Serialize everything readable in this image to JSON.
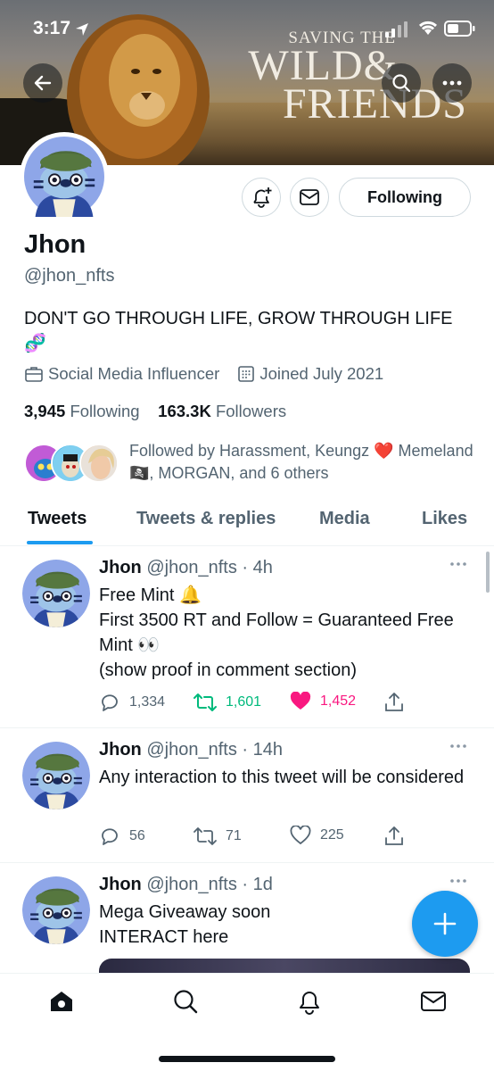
{
  "status_bar": {
    "time": "3:17"
  },
  "banner": {
    "line1": "SAVING THE",
    "line2": "WILD&",
    "line3": "FRIENDS"
  },
  "profile": {
    "name": "Jhon",
    "handle": "@jhon_nfts",
    "bio": "DON'T GO THROUGH LIFE, GROW THROUGH LIFE 🧬",
    "category": "Social Media Influencer",
    "joined": "Joined July 2021",
    "following_count": "3,945",
    "following_label": "Following",
    "followers_count": "163.3K",
    "followers_label": "Followers",
    "followed_by": "Followed by Harassment, Keungz ❤️ Memeland 🏴‍☠️, MORGAN, and 6 others",
    "follow_button_label": "Following"
  },
  "tabs": [
    {
      "label": "Tweets",
      "active": true
    },
    {
      "label": "Tweets & replies",
      "active": false
    },
    {
      "label": "Media",
      "active": false
    },
    {
      "label": "Likes",
      "active": false
    }
  ],
  "tweets": [
    {
      "name": "Jhon",
      "handle": "@jhon_nfts",
      "time": "· 4h",
      "text": "Free Mint 🔔\nFirst 3500 RT and Follow  = Guaranteed Free Mint 👀\n(show proof in comment section)",
      "replies": "1,334",
      "retweets": "1,601",
      "likes": "1,452",
      "retweeted": true,
      "liked": true
    },
    {
      "name": "Jhon",
      "handle": "@jhon_nfts",
      "time": "· 14h",
      "text": "Any interaction to this tweet will be considered",
      "replies": "56",
      "retweets": "71",
      "likes": "225",
      "retweeted": false,
      "liked": false
    },
    {
      "name": "Jhon",
      "handle": "@jhon_nfts",
      "time": "· 1d",
      "text": "Mega Giveaway soon\nINTERACT here"
    }
  ],
  "colors": {
    "accent": "#1d9bf0",
    "retweet_green": "#00ba7c",
    "like_pink": "#f91880",
    "secondary_text": "#536471"
  },
  "icons": {
    "nav": [
      "home-icon",
      "search-icon",
      "bell-icon",
      "mail-icon"
    ],
    "fab": "compose-plus-icon"
  }
}
